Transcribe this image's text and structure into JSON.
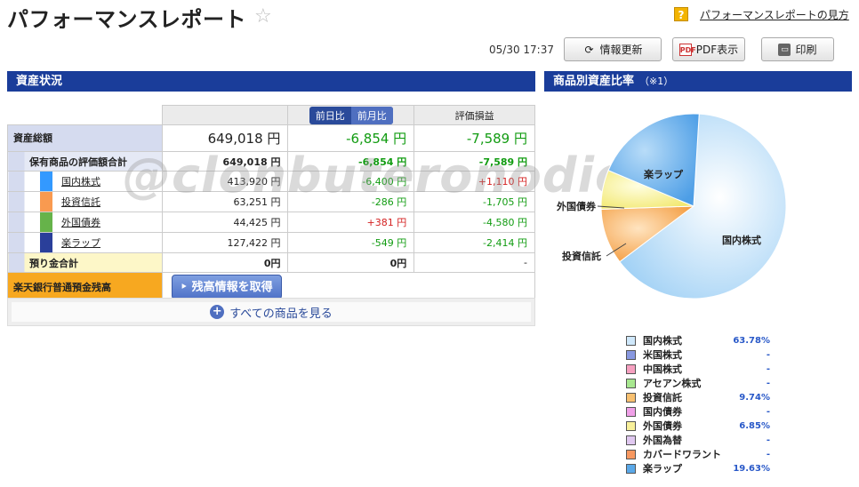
{
  "header": {
    "title": "パフォーマンスレポート",
    "help_label": "?",
    "help_link": "パフォーマンスレポートの見方"
  },
  "toolbar": {
    "datetime": "05/30 17:37",
    "refresh_label": "情報更新",
    "pdf_label": "PDF表示",
    "print_label": "印刷",
    "pdf_icon_text": "PDF"
  },
  "watermark": "@clonbuteronodiet",
  "assets": {
    "section_title": "資産状況",
    "tab_prev_day": "前日比",
    "tab_prev_month": "前月比",
    "col_eval": "評価損益",
    "total": {
      "label": "資産総額",
      "value": "649,018 円",
      "change": "-6,854 円",
      "eval": "-7,589 円"
    },
    "holdings": {
      "label": "保有商品の評価額合計",
      "value": "649,018 円",
      "change": "-6,854 円",
      "eval": "-7,589 円"
    },
    "items": [
      {
        "label": "国内株式",
        "color": "#3399ff",
        "value": "413,920 円",
        "change": "-6,400 円",
        "change_color": "green",
        "eval": "+1,110 円",
        "eval_color": "red"
      },
      {
        "label": "投資信託",
        "color": "#f99a50",
        "value": "63,251 円",
        "change": "-286 円",
        "change_color": "green",
        "eval": "-1,705 円",
        "eval_color": "green"
      },
      {
        "label": "外国債券",
        "color": "#66b34a",
        "value": "44,425 円",
        "change": "+381 円",
        "change_color": "red",
        "eval": "-4,580 円",
        "eval_color": "green"
      },
      {
        "label": "楽ラップ",
        "color": "#2a3f9a",
        "value": "127,422 円",
        "change": "-549 円",
        "change_color": "green",
        "eval": "-2,414 円",
        "eval_color": "green"
      }
    ],
    "deposit": {
      "label": "預り金合計",
      "value": "0円",
      "change": "0円",
      "eval": "-"
    },
    "bank": {
      "label": "楽天銀行普通預金残高",
      "button": "残高情報を取得"
    },
    "see_all": "すべての商品を見る"
  },
  "ratio": {
    "section_title": "商品別資産比率",
    "section_note": "（※1）",
    "pie_labels": {
      "domestic": "国内株式",
      "rakuwrap": "楽ラップ",
      "foreign_bond": "外国債券",
      "fund": "投資信託"
    },
    "legend": [
      {
        "name": "国内株式",
        "pct": "63.78%",
        "color": "#cfe8fb"
      },
      {
        "name": "米国株式",
        "pct": "-",
        "color": "#8898e0"
      },
      {
        "name": "中国株式",
        "pct": "-",
        "color": "#f6a0c0"
      },
      {
        "name": "アセアン株式",
        "pct": "-",
        "color": "#a8e890"
      },
      {
        "name": "投資信託",
        "pct": "9.74%",
        "color": "#f8c070"
      },
      {
        "name": "国内債券",
        "pct": "-",
        "color": "#f0a0e8"
      },
      {
        "name": "外国債券",
        "pct": "6.85%",
        "color": "#f8f09a"
      },
      {
        "name": "外国為替",
        "pct": "-",
        "color": "#e0c8f0"
      },
      {
        "name": "カバードワラント",
        "pct": "-",
        "color": "#f89860"
      },
      {
        "name": "楽ラップ",
        "pct": "19.63%",
        "color": "#5aa8e8"
      }
    ]
  },
  "chart_data": {
    "type": "pie",
    "categories": [
      "国内株式",
      "投資信託",
      "外国債券",
      "楽ラップ"
    ],
    "values": [
      63.78,
      9.74,
      6.85,
      19.63
    ],
    "colors": [
      "#bfe0fb",
      "#f8b060",
      "#f8f098",
      "#6ab0ea"
    ]
  }
}
